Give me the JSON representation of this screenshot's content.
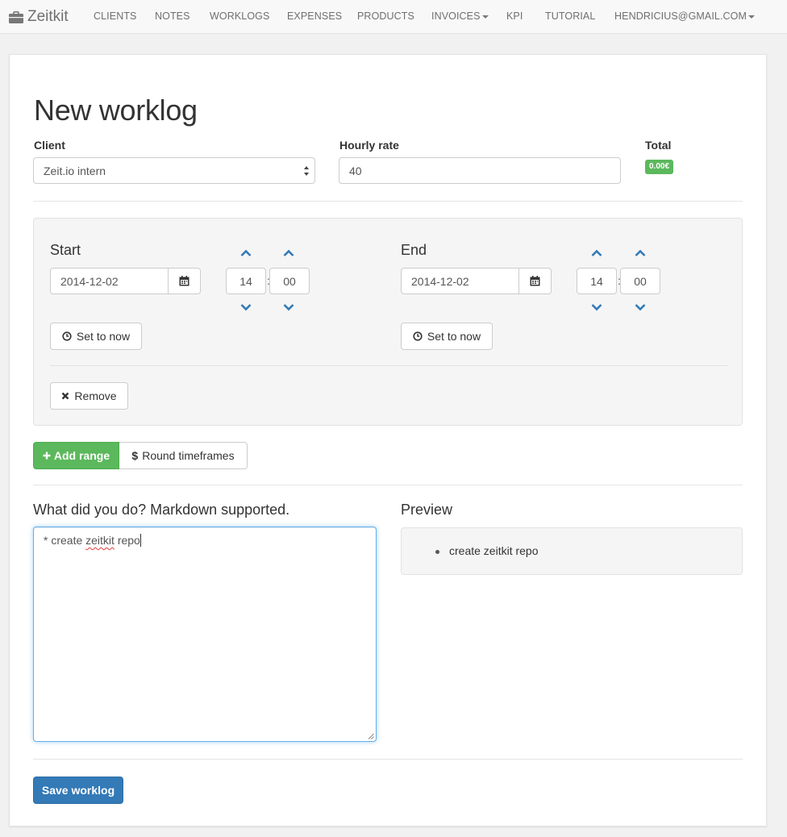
{
  "navbar": {
    "brand": "Zeitkit",
    "items": [
      "CLIENTS",
      "NOTES",
      "WORKLOGS",
      "EXPENSES",
      "PRODUCTS",
      "INVOICES",
      "KPI",
      "TUTORIAL",
      "HENDRICIUS@GMAIL.COM"
    ],
    "dropdown_items": [
      "INVOICES",
      "HENDRICIUS@GMAIL.COM"
    ]
  },
  "page": {
    "title": "New worklog"
  },
  "form": {
    "client_label": "Client",
    "client_value": "Zeit.io intern",
    "rate_label": "Hourly rate",
    "rate_value": "40",
    "total_label": "Total",
    "total_value": "0.00€"
  },
  "range": {
    "start": {
      "label": "Start",
      "date": "2014-12-02",
      "hour": "14",
      "minute": "00",
      "set_now": "Set to now"
    },
    "end": {
      "label": "End",
      "date": "2014-12-02",
      "hour": "14",
      "minute": "00",
      "set_now": "Set to now"
    },
    "colon": ":",
    "remove": "Remove"
  },
  "actions": {
    "add_range": "Add range",
    "round_timeframes": "Round timeframes"
  },
  "summary": {
    "label": "What did you do? Markdown supported.",
    "prefix": "* create ",
    "misspelled": "zeitkit",
    "suffix": " repo",
    "preview_label": "Preview",
    "preview_item": "create zeitkit repo"
  },
  "save_button": "Save worklog",
  "colors": {
    "success": "#5cb85c",
    "primary": "#337ab7",
    "link_blue": "#337ab7"
  },
  "icons": [
    "briefcase-icon",
    "calendar-icon",
    "chevron-up-icon",
    "chevron-down-icon",
    "clock-icon",
    "remove-icon",
    "plus-icon",
    "dollar-icon"
  ]
}
